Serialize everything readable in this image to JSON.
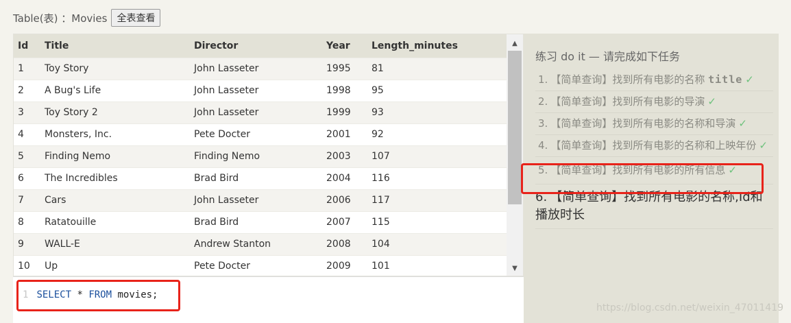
{
  "header": {
    "label": "Table(表) ：Movies",
    "show_all_button": "全表查看"
  },
  "table": {
    "columns": [
      "Id",
      "Title",
      "Director",
      "Year",
      "Length_minutes"
    ],
    "rows": [
      [
        "1",
        "Toy Story",
        "John Lasseter",
        "1995",
        "81"
      ],
      [
        "2",
        "A Bug's Life",
        "John Lasseter",
        "1998",
        "95"
      ],
      [
        "3",
        "Toy Story 2",
        "John Lasseter",
        "1999",
        "93"
      ],
      [
        "4",
        "Monsters, Inc.",
        "Pete Docter",
        "2001",
        "92"
      ],
      [
        "5",
        "Finding Nemo",
        "Finding Nemo",
        "2003",
        "107"
      ],
      [
        "6",
        "The Incredibles",
        "Brad Bird",
        "2004",
        "116"
      ],
      [
        "7",
        "Cars",
        "John Lasseter",
        "2006",
        "117"
      ],
      [
        "8",
        "Ratatouille",
        "Brad Bird",
        "2007",
        "115"
      ],
      [
        "9",
        "WALL-E",
        "Andrew Stanton",
        "2008",
        "104"
      ],
      [
        "10",
        "Up",
        "Pete Docter",
        "2009",
        "101"
      ]
    ],
    "scroll_up_icon": "triangle-up-icon",
    "scroll_down_icon": "triangle-down-icon"
  },
  "editor": {
    "line_number": "1",
    "kw_select": "SELECT",
    "star": "*",
    "kw_from": "FROM",
    "table_name": "movies;"
  },
  "tasks": {
    "header": "练习 do it — 请完成如下任务",
    "check_mark": "✓",
    "items": [
      {
        "num": "1.",
        "text": "【简单查询】找到所有电影的名称",
        "code": "title"
      },
      {
        "num": "2.",
        "text": "【简单查询】找到所有电影的导演"
      },
      {
        "num": "3.",
        "text": "【简单查询】找到所有电影的名称和导演"
      },
      {
        "num": "4.",
        "text": "【简单查询】找到所有电影的名称和上映年份"
      },
      {
        "num": "5.",
        "text": "【简单查询】找到所有电影的所有信息"
      }
    ],
    "current": {
      "num": "6.",
      "text": "【简单查询】找到所有电影的名称,Id和播放时长"
    }
  },
  "watermark": "https://blog.csdn.net/weixin_47011419",
  "colors": {
    "highlight": "#e8231a",
    "check": "#6ec27d",
    "keyword": "#1a4f9c"
  }
}
